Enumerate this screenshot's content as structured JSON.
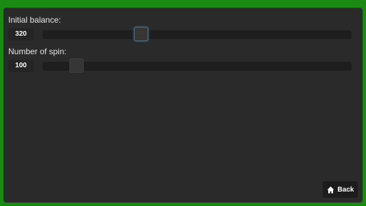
{
  "balance": {
    "label": "Initial balance:",
    "value": "320",
    "level": 0.31
  },
  "spins": {
    "label": "Number of spin:",
    "value": "100",
    "level": 0.09
  },
  "back_button": {
    "label": "Back",
    "icon": "home-icon"
  },
  "colors": {
    "frame": "#1a8a12",
    "panel": "#2a2a2a",
    "focus": "#2c7fb8"
  }
}
